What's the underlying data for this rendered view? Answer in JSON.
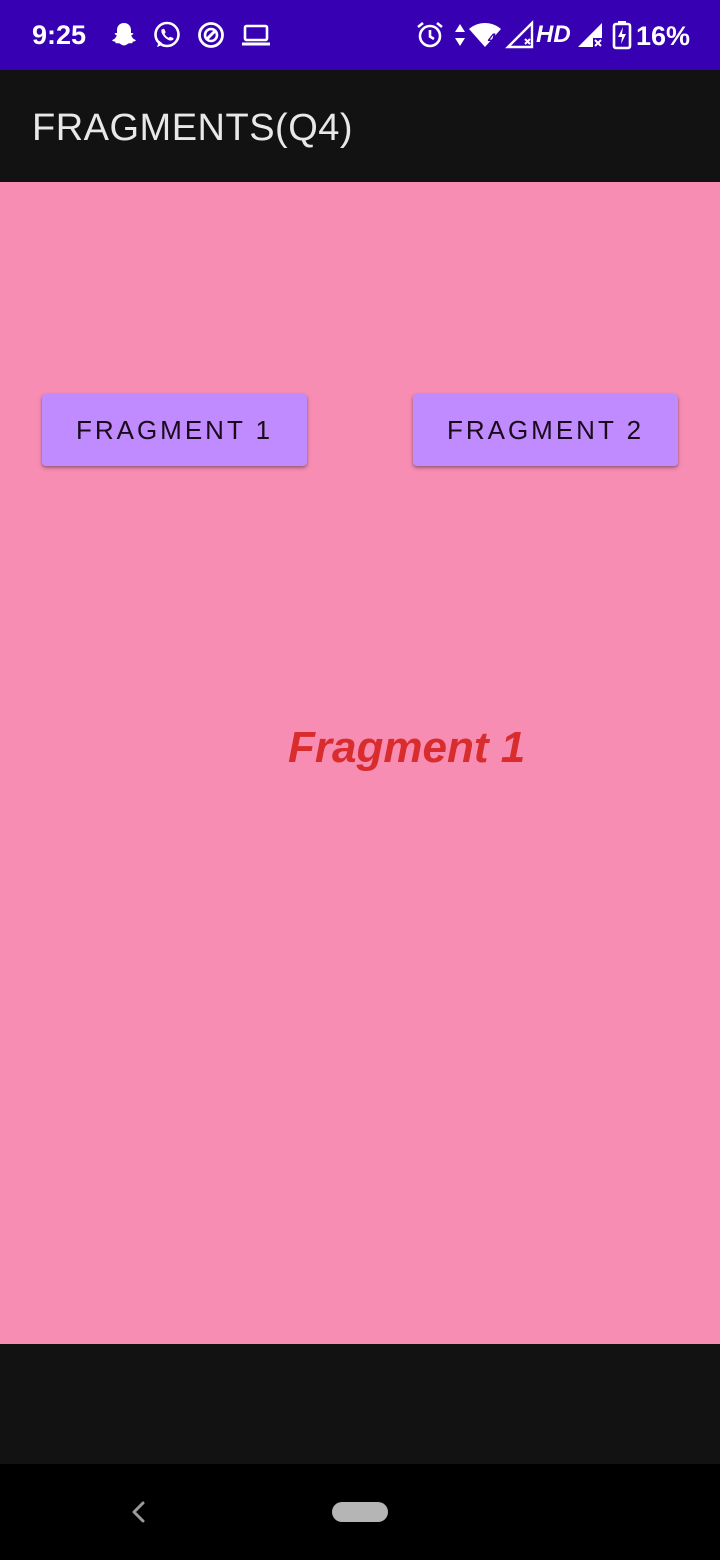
{
  "status_bar": {
    "time": "9:25",
    "network_label": "HD",
    "wifi_badge": "4",
    "battery_percent": "16%",
    "background_color": "#3700b3",
    "icons": [
      "snapchat-icon",
      "whatsapp-icon",
      "circle-app-icon",
      "laptop-icon",
      "alarm-icon",
      "data-arrows-icon",
      "wifi-icon",
      "signal-icon",
      "signal-icon-2",
      "battery-charging-icon"
    ]
  },
  "app_bar": {
    "title": "FRAGMENTS(Q4)",
    "background_color": "#121212"
  },
  "main": {
    "background_color": "#f78db3",
    "buttons": [
      {
        "label": "FRAGMENT 1"
      },
      {
        "label": "FRAGMENT 2"
      }
    ],
    "button_color": "#bf8bff",
    "fragment_text": "Fragment 1",
    "fragment_text_color": "#d92c2c"
  },
  "nav_bar": {
    "icons": [
      "back-icon",
      "home-pill-icon"
    ]
  }
}
